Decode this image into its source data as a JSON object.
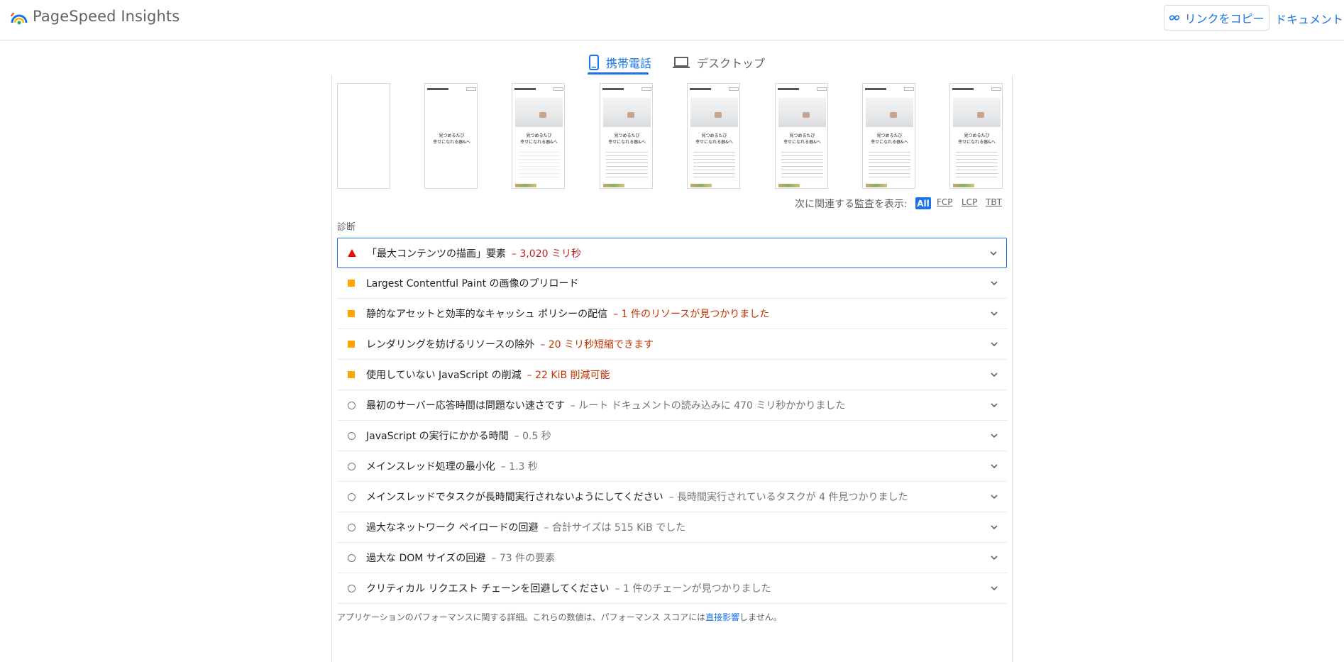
{
  "header": {
    "brand": "PageSpeed Insights",
    "copy_link_label": "リンクをコピー",
    "docs_label": "ドキュメント"
  },
  "tabs": [
    {
      "label": "携帯電話",
      "icon": "smartphone-icon",
      "active": true
    },
    {
      "label": "デスクトップ",
      "icon": "laptop-icon",
      "active": false
    }
  ],
  "filmstrip": {
    "frames": [
      {
        "site": "",
        "menu": "",
        "caption": "",
        "state": "blank"
      },
      {
        "site": "MOMO Nutfrate",
        "menu": "Menu",
        "caption": "見つめるたび\n幸せになれる器&へ",
        "state": "text"
      },
      {
        "site": "MOMO Nutfrate",
        "menu": "Menu",
        "caption": "見つめるたび\n幸せになれる器&へ",
        "state": "partial"
      },
      {
        "site": "MOMO Nutfrate",
        "menu": "Menu",
        "caption": "見つめるたび\n幸せになれる器&へ",
        "state": "full"
      },
      {
        "site": "MOMO Nutfrate",
        "menu": "Menu",
        "caption": "見つめるたび\n幸せになれる器&へ",
        "state": "full"
      },
      {
        "site": "MOMO Nutfrate",
        "menu": "Menu",
        "caption": "見つめるたび\n幸せになれる器&へ",
        "state": "full"
      },
      {
        "site": "MOMO Nutfrate",
        "menu": "Menu",
        "caption": "見つめるたび\n幸せになれる器&へ",
        "state": "full"
      },
      {
        "site": "MOMO Nutfrate",
        "menu": "Menu",
        "caption": "見つめるたび\n幸せになれる器&へ",
        "state": "full"
      }
    ]
  },
  "filter": {
    "label": "次に関連する監査を表示:",
    "chips": [
      "All",
      "FCP",
      "LCP",
      "TBT"
    ],
    "selected": "All"
  },
  "section_label": "診断",
  "audits": [
    {
      "status": "fail",
      "title": "「最大コンテンツの描画」要素",
      "detail": "– 3,020 ミリ秒"
    },
    {
      "status": "average",
      "title": "Largest Contentful Paint の画像のプリロード",
      "detail": ""
    },
    {
      "status": "average",
      "title": "静的なアセットと効率的なキャッシュ ポリシーの配信",
      "detail": "– 1 件のリソースが見つかりました"
    },
    {
      "status": "average",
      "title": "レンダリングを妨げるリソースの除外",
      "detail": "– 20 ミリ秒短縮できます"
    },
    {
      "status": "average",
      "title": "使用していない JavaScript の削減",
      "detail": "– 22 KiB 削減可能"
    },
    {
      "status": "pass",
      "title": "最初のサーバー応答時間は問題ない速さです",
      "detail": "– ルート ドキュメントの読み込みに 470 ミリ秒かかりました"
    },
    {
      "status": "pass",
      "title": "JavaScript の実行にかかる時間",
      "detail": "– 0.5 秒"
    },
    {
      "status": "pass",
      "title": "メインスレッド処理の最小化",
      "detail": "– 1.3 秒"
    },
    {
      "status": "pass",
      "title": "メインスレッドでタスクが長時間実行されないようにしてください",
      "detail": "– 長時間実行されているタスクが 4 件見つかりました"
    },
    {
      "status": "pass",
      "title": "過大なネットワーク ペイロードの回避",
      "detail": "– 合計サイズは 515 KiB でした"
    },
    {
      "status": "pass",
      "title": "過大な DOM サイズの回避",
      "detail": "– 73 件の要素"
    },
    {
      "status": "pass",
      "title": "クリティカル リクエスト チェーンを回避してください",
      "detail": "– 1 件のチェーンが見つかりました"
    }
  ],
  "footnote": {
    "before": "アプリケーションのパフォーマンスに関する詳細。これらの数値は、パフォーマンス スコアには",
    "link": "直接影響",
    "after": "しません。"
  },
  "colors": {
    "accent": "#1a73e8",
    "fail": "#eb0f00",
    "average": "#ffa400",
    "pass": "#757575"
  }
}
